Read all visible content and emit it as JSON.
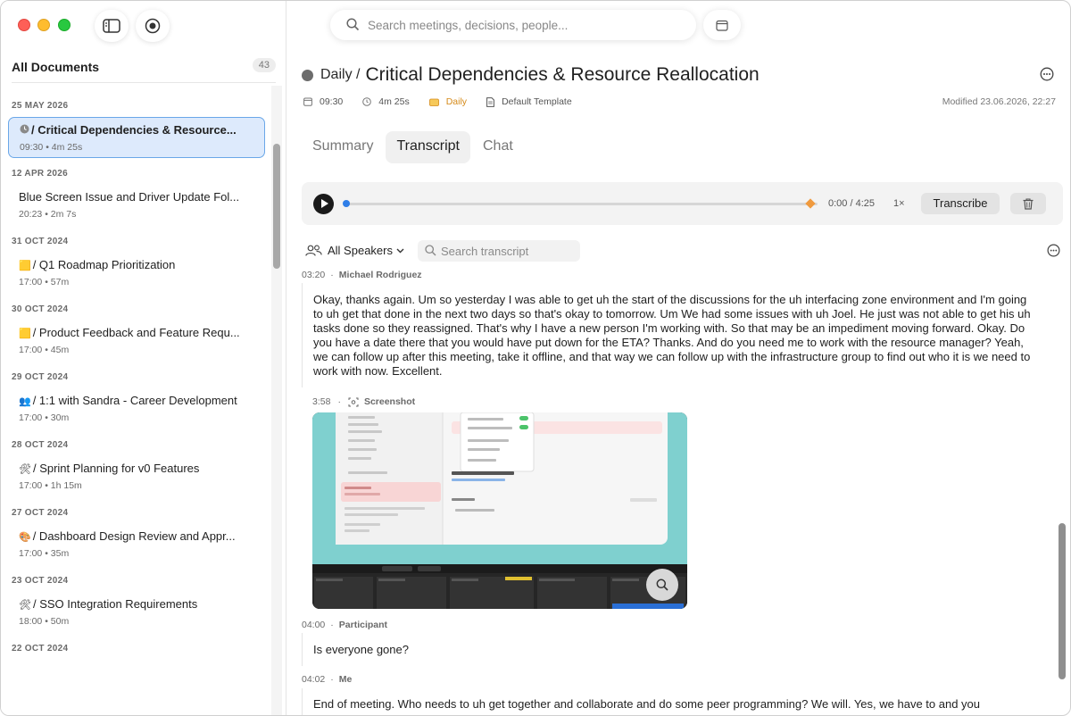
{
  "sidebar": {
    "title": "All Documents",
    "count": "43",
    "groups": [
      {
        "date": "25 MAY 2026",
        "items": [
          {
            "title": "/ Critical Dependencies & Resource...",
            "meta": "09:30 • 4m 25s",
            "selected": true
          }
        ]
      },
      {
        "date": "12 APR 2026",
        "items": [
          {
            "title": "Blue Screen Issue and Driver Update Fol...",
            "meta": "20:23 • 2m 7s"
          }
        ]
      },
      {
        "date": "31 OCT 2024",
        "items": [
          {
            "title": "/ Q1 Roadmap Prioritization",
            "meta": "17:00 • 57m"
          }
        ]
      },
      {
        "date": "30 OCT 2024",
        "items": [
          {
            "title": "/ Product Feedback and Feature Requ...",
            "meta": "17:00 • 45m"
          }
        ]
      },
      {
        "date": "29 OCT 2024",
        "items": [
          {
            "title": "/ 1:1 with Sandra - Career Development",
            "meta": "17:00 • 30m"
          }
        ]
      },
      {
        "date": "28 OCT 2024",
        "items": [
          {
            "title": "/ Sprint Planning for v0 Features",
            "meta": "17:00 • 1h 15m"
          }
        ]
      },
      {
        "date": "27 OCT 2024",
        "items": [
          {
            "title": "/ Dashboard Design Review and Appr...",
            "meta": "17:00 • 35m"
          }
        ]
      },
      {
        "date": "23 OCT 2024",
        "items": [
          {
            "title": "/ SSO Integration Requirements",
            "meta": "18:00 • 50m"
          }
        ]
      },
      {
        "date": "22 OCT 2024",
        "items": []
      }
    ]
  },
  "search": {
    "placeholder": "Search meetings, decisions, people..."
  },
  "doc": {
    "crumb": "Daily /",
    "title": "Critical Dependencies & Resource Reallocation",
    "time": "09:30",
    "duration": "4m 25s",
    "category": "Daily",
    "template": "Default Template",
    "modified": "Modified 23.06.2026, 22:27"
  },
  "tabs": {
    "summary": "Summary",
    "transcript": "Transcript",
    "chat": "Chat"
  },
  "player": {
    "time": "0:00 / 4:25",
    "speed": "1×",
    "transcribe": "Transcribe",
    "progress": 0.0
  },
  "filter": {
    "speakers": "All Speakers",
    "search_placeholder": "Search transcript"
  },
  "segments": [
    {
      "time": "03:20",
      "speaker": "Michael Rodriguez",
      "text": "Okay, thanks again. Um so yesterday I was able to get uh the start of the discussions for the uh interfacing zone environment and I'm going to uh get that done in the next two days so that's okay to tomorrow. Um We had some issues with uh Joel. He just was not able to get his uh tasks done so they reassigned. That's why I have a new person I'm working with. So that may be an impediment moving forward. Okay. Do you have a date there that you would have put down for the ETA? Thanks. And do you need me to work with the resource manager? Yeah, we can follow up after this meeting, take it offline, and that way we can follow up with the infrastructure group to find out who it is we need to work with now. Excellent."
    },
    {
      "time": "3:58",
      "label": "Screenshot"
    },
    {
      "time": "04:00",
      "speaker": "Participant",
      "text": "Is everyone gone?"
    },
    {
      "time": "04:02",
      "speaker": "Me",
      "text": "End of meeting. Who needs to uh get together and collaborate and do some peer programming? We will. Yes, we have to and you"
    }
  ],
  "colors": {
    "accent": "#2f7ee8",
    "selected_bg": "#ddeafc",
    "daily": "#d58a19",
    "marker": "#f09a3e"
  }
}
